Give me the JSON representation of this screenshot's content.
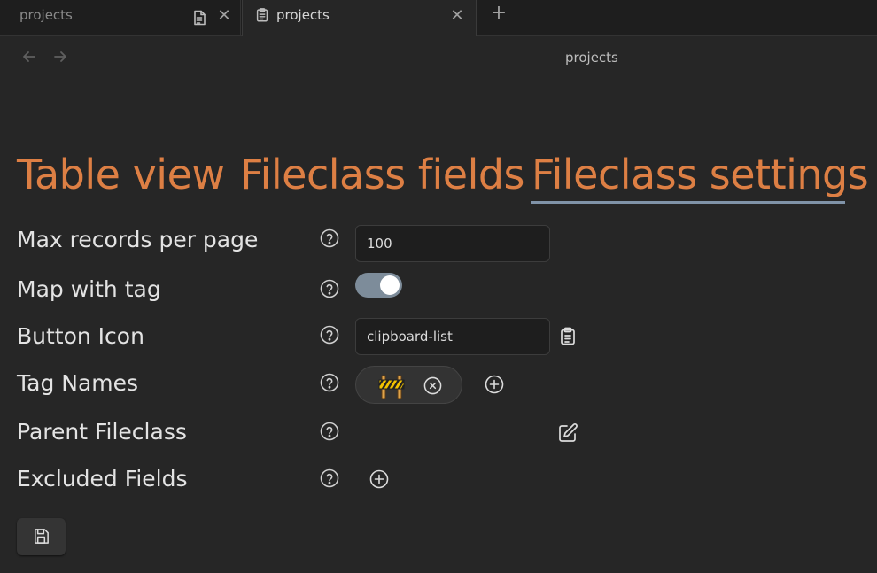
{
  "tabs": [
    {
      "label": "projects",
      "icon": "file-text-icon",
      "active": false
    },
    {
      "label": "projects",
      "icon": "clipboard-list-icon",
      "active": true
    }
  ],
  "view": {
    "title": "projects"
  },
  "sections": [
    {
      "label": "Table view",
      "active": false
    },
    {
      "label": "Fileclass fields",
      "active": false
    },
    {
      "label": "Fileclass settings",
      "active": true
    }
  ],
  "settings": {
    "max_records": {
      "label": "Max records per page",
      "value": "100"
    },
    "map_with_tag": {
      "label": "Map with tag",
      "enabled": true
    },
    "button_icon": {
      "label": "Button Icon",
      "value": "clipboard-list"
    },
    "tag_names": {
      "label": "Tag Names",
      "chip_icon": "construction-emoji"
    },
    "parent_fileclass": {
      "label": "Parent Fileclass"
    },
    "excluded_fields": {
      "label": "Excluded Fields"
    }
  },
  "colors": {
    "accent": "#dd7f44",
    "underline": "#8093a8",
    "toggle_on": "#7d8c9a",
    "background": "#262626"
  }
}
